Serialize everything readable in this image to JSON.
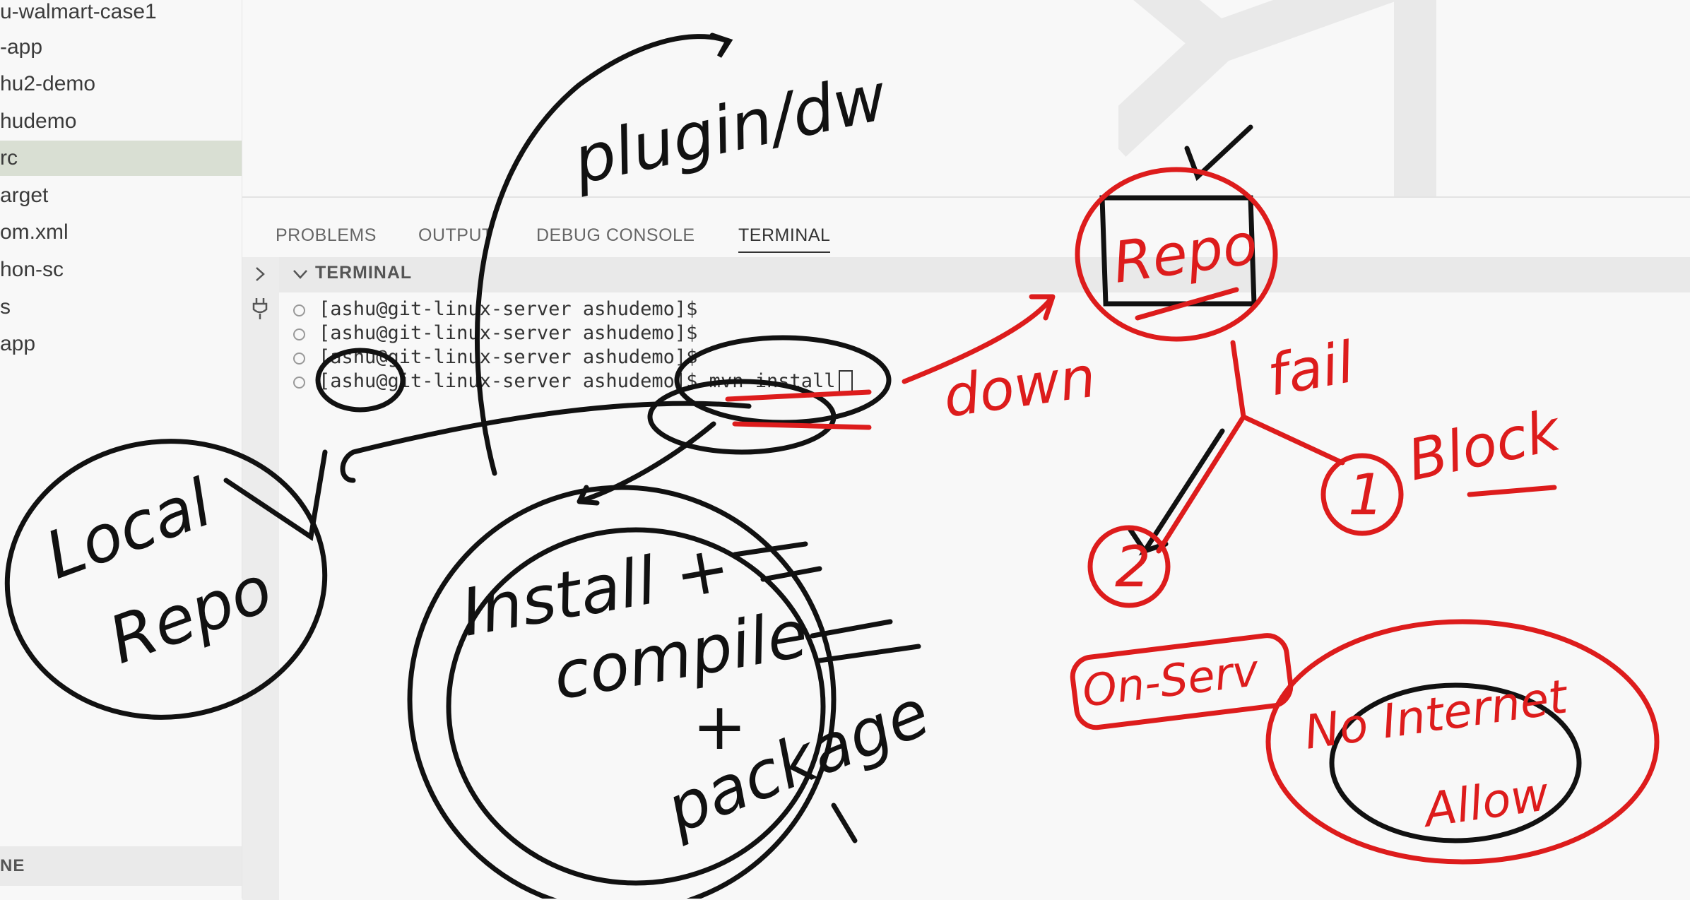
{
  "explorer": {
    "items": [
      {
        "label": "u-walmart-case1",
        "selected": false
      },
      {
        "label": "-app",
        "selected": false
      },
      {
        "label": "hu2-demo",
        "selected": false
      },
      {
        "label": "hudemo",
        "selected": false
      },
      {
        "label": "rc",
        "selected": true
      },
      {
        "label": "arget",
        "selected": false
      },
      {
        "label": "om.xml",
        "selected": false
      },
      {
        "label": "hon-sc",
        "selected": false
      },
      {
        "label": "s",
        "selected": false
      },
      {
        "label": "app",
        "selected": false
      }
    ],
    "outline_label": "NE"
  },
  "panel": {
    "tabs": [
      "PROBLEMS",
      "OUTPUT",
      "DEBUG CONSOLE",
      "TERMINAL"
    ],
    "active_tab": "TERMINAL",
    "terminal_title": "TERMINAL",
    "lines": [
      "[ashu@git-linux-server ashudemo]$",
      "[ashu@git-linux-server ashudemo]$",
      "[ashu@git-linux-server ashudemo]$",
      "[ashu@git-linux-server ashudemo]$ mvn install"
    ]
  },
  "annotations": {
    "black_ink": [
      "plugin/dw",
      "Local",
      "Repo",
      "Install +",
      "compile",
      "+",
      "package"
    ],
    "red_ink": [
      "Repo",
      "down",
      "fail",
      "Block",
      "1",
      "2",
      "On-Serv",
      "No Internet",
      "Allow"
    ],
    "colors": {
      "black_ink": "#111111",
      "red_ink": "#dd1c1c"
    }
  }
}
